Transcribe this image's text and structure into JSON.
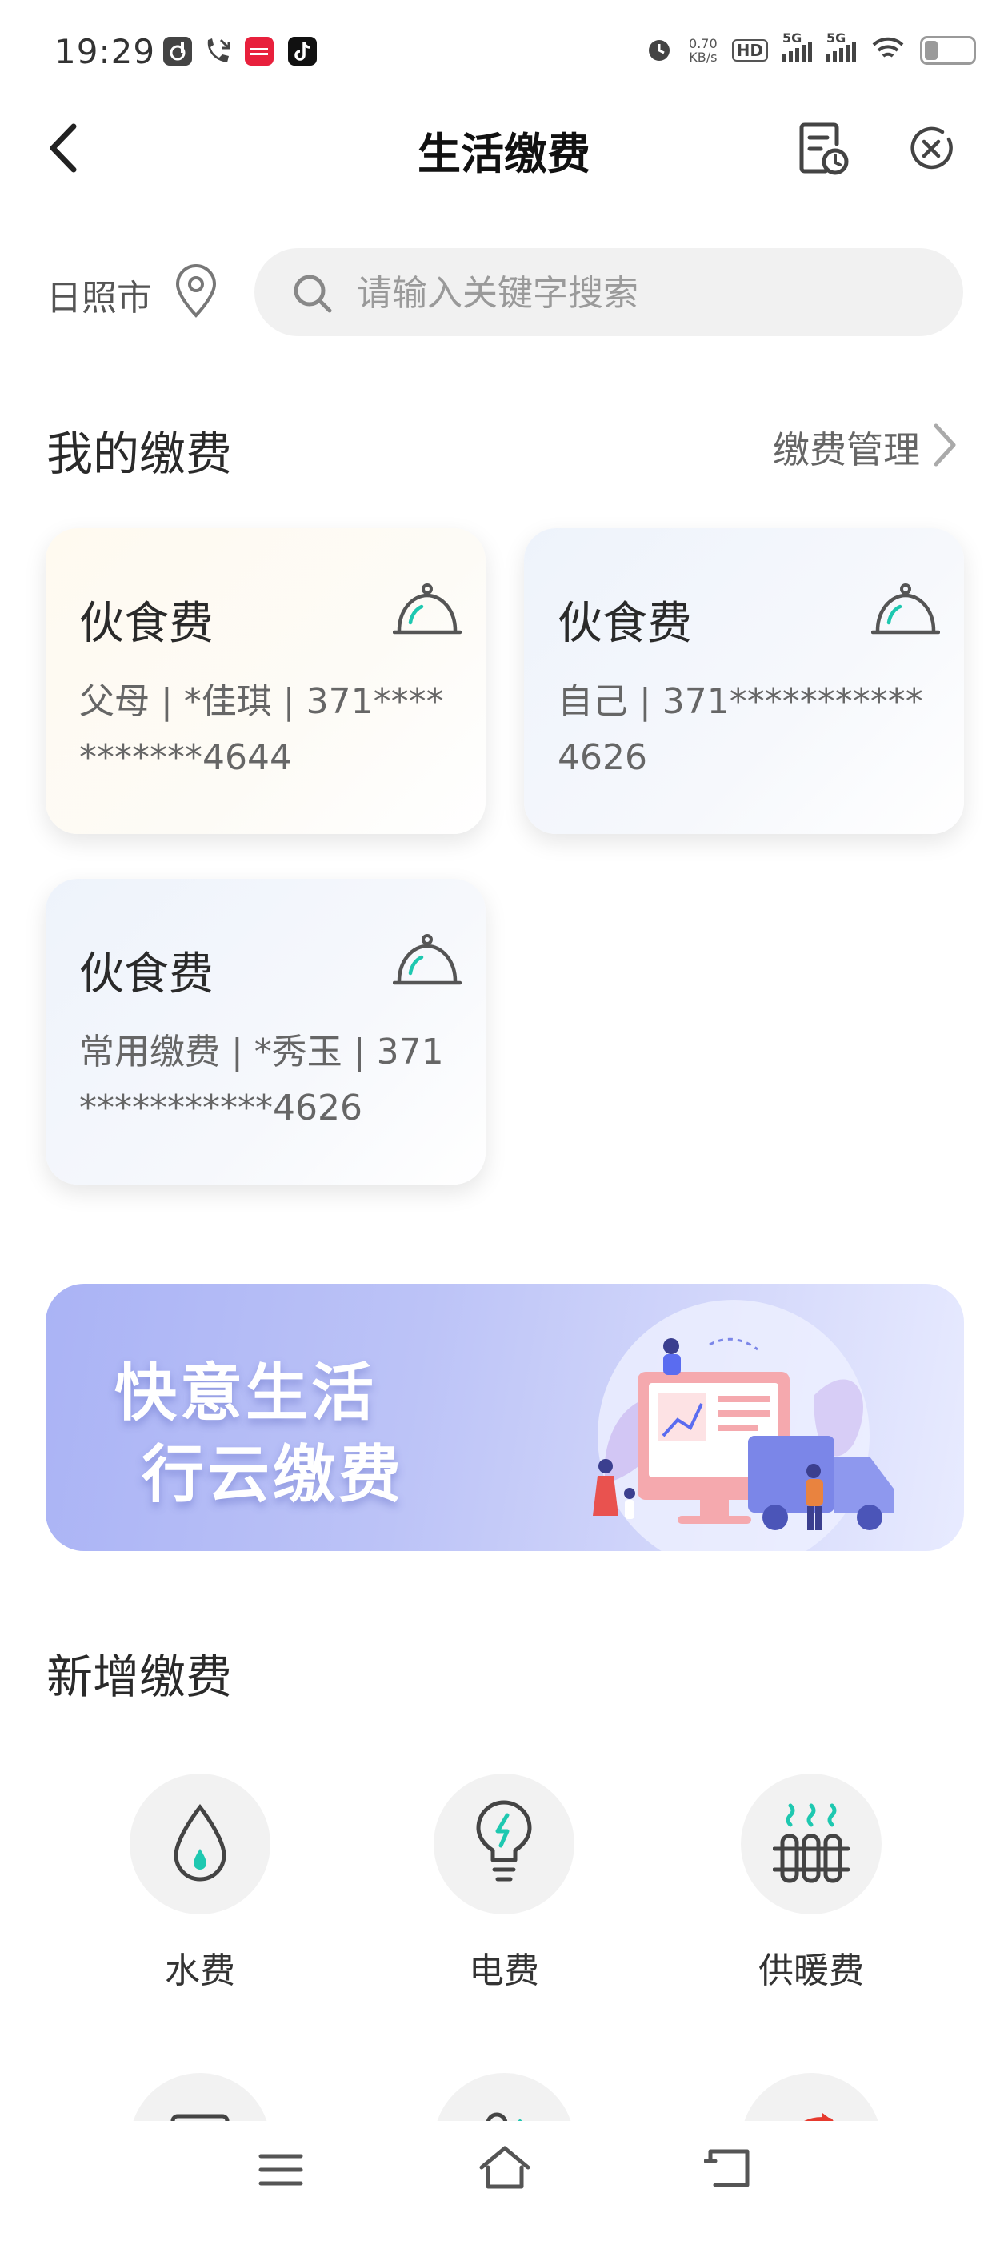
{
  "status_bar": {
    "time": "19:29",
    "net_speed_value": "0.70",
    "net_speed_unit": "KB/s",
    "hd_label": "HD",
    "sim1_label": "5G",
    "sim2_label": "5G",
    "battery_level": 0.3
  },
  "header": {
    "title": "生活缴费"
  },
  "location": {
    "city": "日照市"
  },
  "search": {
    "placeholder": "请输入关键字搜索"
  },
  "my_payments": {
    "title": "我的缴费",
    "manage_label": "缴费管理",
    "cards": [
      {
        "title": "伙食费",
        "detail": "父母 | *佳琪 | 371***********4644"
      },
      {
        "title": "伙食费",
        "detail": "自己 | 371***********4626"
      },
      {
        "title": "伙食费",
        "detail": "常用缴费 | *秀玉 | 371***********4626"
      }
    ]
  },
  "banner": {
    "line1": "快意生活",
    "line2": "行云缴费"
  },
  "new_payment": {
    "title": "新增缴费",
    "services": [
      {
        "label": "水费",
        "icon": "water-drop-icon"
      },
      {
        "label": "电费",
        "icon": "light-bulb-icon"
      },
      {
        "label": "供暖费",
        "icon": "heater-icon"
      }
    ]
  },
  "colors": {
    "accent_teal": "#1ec8b0",
    "icon_gray": "#555555",
    "banner_blue": "#aab3f5"
  }
}
